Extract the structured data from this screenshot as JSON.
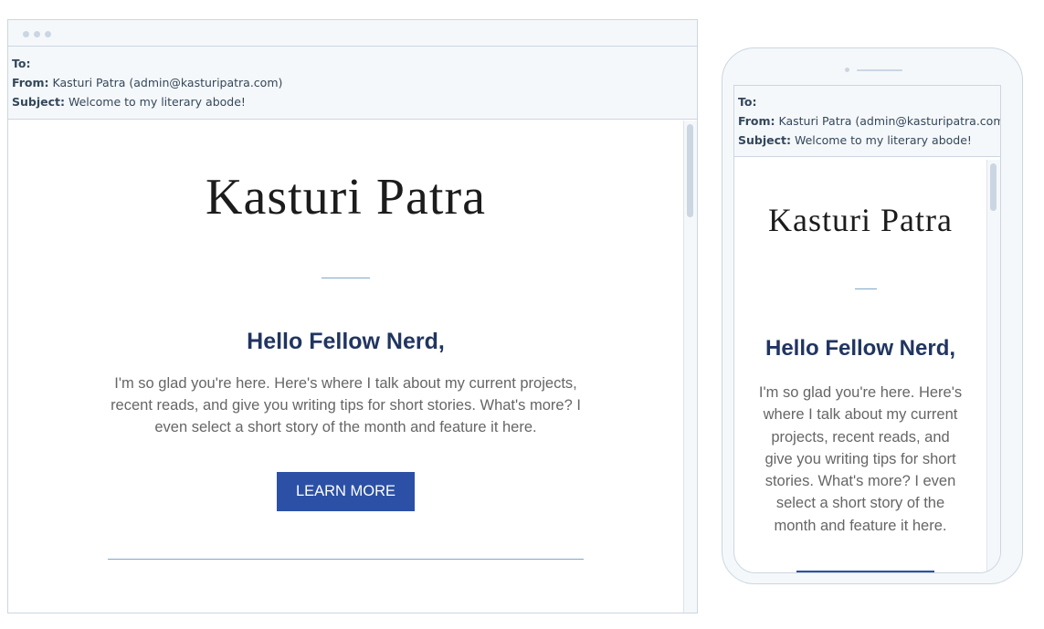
{
  "email": {
    "to_label": "To:",
    "to_value": "",
    "from_label": "From:",
    "from_value": "Kasturi Patra (admin@kasturipatra.com)",
    "subject_label": "Subject:",
    "subject_value": "Welcome to my literary abode!"
  },
  "content": {
    "brand": "Kasturi Patra",
    "greeting": "Hello Fellow Nerd,",
    "paragraph": "I'm so glad you're here. Here's where I talk about my current projects, recent reads, and give you writing tips for short stories. What's more? I even select a short story of the month and feature it here.",
    "cta_label": "LEARN MORE"
  },
  "colors": {
    "accent_button": "#2b50a6",
    "heading": "#213561",
    "divider": "#7fa8cc",
    "chrome_bg": "#f5f8fa",
    "border": "#cbd6e2"
  }
}
